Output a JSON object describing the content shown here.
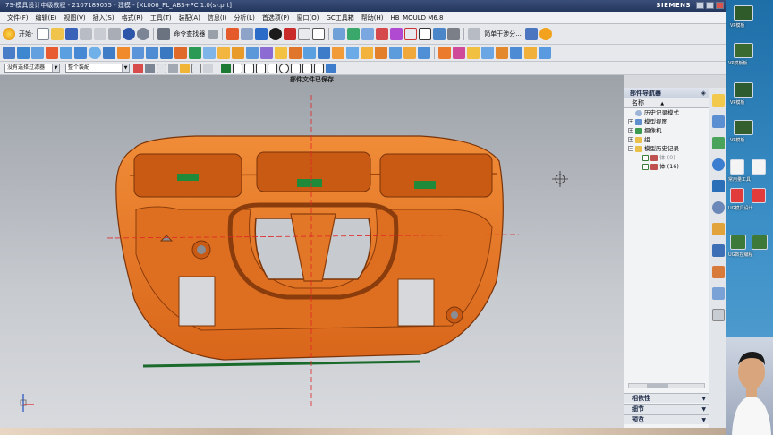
{
  "window": {
    "title": "7S-模具设计中级教程 - 2107189055 - 建模 - [XL006_FL_ABS+PC 1.0(s).prt]",
    "brand": "SIEMENS"
  },
  "menu": [
    "文件(F)",
    "编辑(E)",
    "视图(V)",
    "插入(S)",
    "格式(R)",
    "工具(T)",
    "装配(A)",
    "信息(I)",
    "分析(L)",
    "首选项(P)",
    "窗口(O)",
    "GC工具箱",
    "帮助(H)",
    "HB_MOULD M6.8"
  ],
  "toolbar1": {
    "start_label": "开始·",
    "command_finder": "命令查找器",
    "simple_interference": "简单干涉分..."
  },
  "toolbar3": {
    "selection_filter": "没有选择过滤器",
    "assembly_scope": "整个装配"
  },
  "status": {
    "message": "部件文件已保存"
  },
  "navigator": {
    "title": "部件导航器",
    "column_name": "名称",
    "sort_indicator": "▲",
    "items": [
      {
        "label": "历史记录模式",
        "dim": false
      },
      {
        "label": "模型视图",
        "dim": false
      },
      {
        "label": "摄像机",
        "dim": false
      },
      {
        "label": "组",
        "dim": false
      },
      {
        "label": "模型历史记录",
        "dim": false
      },
      {
        "label": "体 (0)",
        "dim": true
      },
      {
        "label": "体 (16)",
        "dim": false
      }
    ],
    "sections": [
      "相依性",
      "细节",
      "预览"
    ]
  },
  "desktop": {
    "labels": [
      "VP模板",
      "VP模板板",
      "VP模板",
      "VP模板",
      "常用量工具",
      "量具工具",
      "模具",
      "2.0",
      "UG模具设计",
      "UG数控编程",
      "2.0",
      "UG.0"
    ]
  },
  "colors": {
    "part_orange": "#e8781e",
    "part_dark": "#b44f0d",
    "accent_green": "#1e8a3a",
    "origin_red": "#e02525"
  }
}
